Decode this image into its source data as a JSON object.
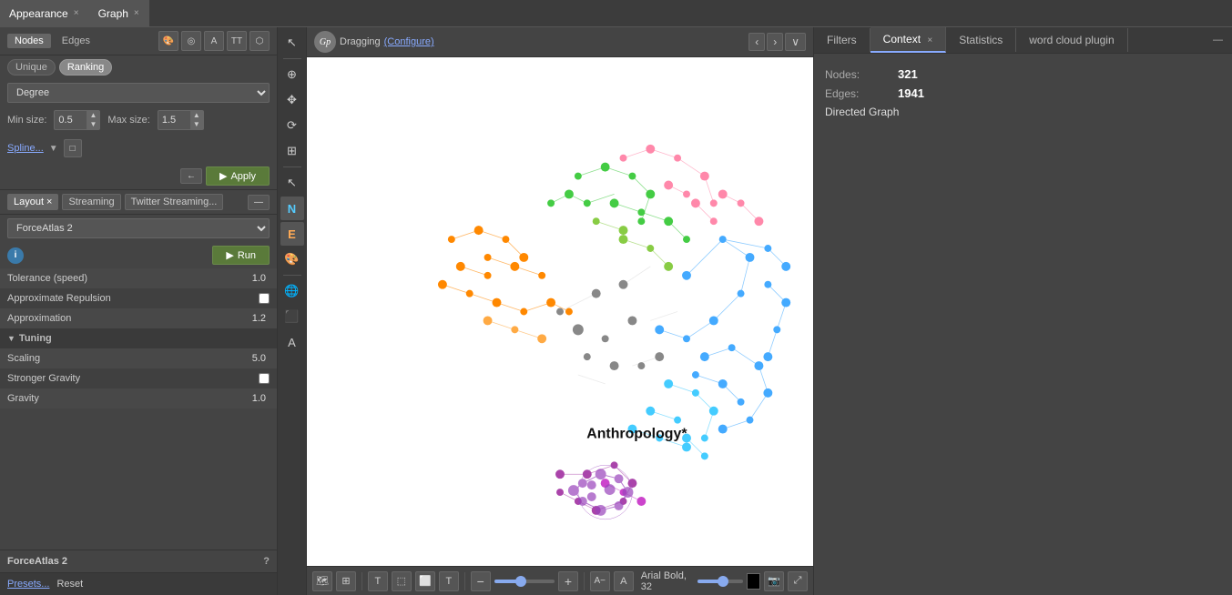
{
  "appearance_tab": {
    "label": "Appearance",
    "close": "×"
  },
  "graph_tab": {
    "label": "Graph",
    "close": "×"
  },
  "nodes_btn": "Nodes",
  "edges_btn": "Edges",
  "toolbar_icons": [
    "🎨",
    "↺",
    "A",
    "TT",
    "⬡"
  ],
  "unique_tab": "Unique",
  "ranking_tab": "Ranking",
  "degree_options": [
    "Degree"
  ],
  "minsize_label": "Min size:",
  "minsize_value": "0.5",
  "maxsize_label": "Max size:",
  "maxsize_value": "1.5",
  "spline_label": "Spline...",
  "apply_label": "Apply",
  "layout_tab": {
    "label": "Layout",
    "close": "×"
  },
  "streaming_tab": "Streaming",
  "twitter_tab": "Twitter Streaming...",
  "layout_options": [
    "ForceAtlas 2"
  ],
  "run_label": "Run",
  "tolerance_label": "Tolerance (speed)",
  "tolerance_value": "1.0",
  "approx_repulsion_label": "Approximate Repulsion",
  "approximation_label": "Approximation",
  "approximation_value": "1.2",
  "tuning_label": "Tuning",
  "scaling_label": "Scaling",
  "scaling_value": "5.0",
  "stronger_gravity_label": "Stronger Gravity",
  "gravity_label": "Gravity",
  "gravity_value": "1.0",
  "footer_layout": "ForceAtlas 2",
  "presets_label": "Presets...",
  "reset_label": "Reset",
  "drag_label": "Dragging",
  "configure_label": "(Configure)",
  "graph_label": "Anthropology*",
  "filters_tab": "Filters",
  "context_tab": "Context",
  "statistics_tab": "Statistics",
  "wordcloud_tab": "word cloud plugin",
  "nodes_label": "Nodes:",
  "nodes_value": "321",
  "edges_label": "Edges:",
  "edges_value": "1941",
  "directed_label": "Directed Graph",
  "font_label": "Arial Bold, 32",
  "bottom_tools": [
    "🗺",
    "⊞",
    "T",
    "⬚",
    "⬜",
    "T"
  ]
}
